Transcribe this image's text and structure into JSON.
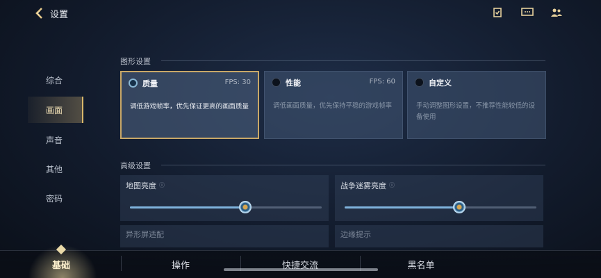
{
  "header": {
    "back_label": "设置",
    "icons": [
      "clipboard-check-icon",
      "chat-icon",
      "friends-icon"
    ]
  },
  "sidebar": {
    "items": [
      {
        "label": "综合"
      },
      {
        "label": "画面",
        "active": true
      },
      {
        "label": "声音"
      },
      {
        "label": "其他"
      },
      {
        "label": "密码"
      }
    ]
  },
  "graphics": {
    "title": "图形设置",
    "presets": [
      {
        "name": "质量",
        "fps": "FPS: 30",
        "desc": "调低游戏帧率，优先保证更高的画面质量",
        "selected": true
      },
      {
        "name": "性能",
        "fps": "FPS: 60",
        "desc": "调低画面质量，优先保持平稳的游戏帧率",
        "selected": false
      },
      {
        "name": "自定义",
        "fps": "",
        "desc": "手动调整图形设置，不推荐性能较低的设备使用",
        "selected": false
      }
    ]
  },
  "advanced": {
    "title": "高级设置",
    "map_brightness": {
      "label": "地图亮度",
      "info": "ⓘ",
      "value": 0.5
    },
    "fog_brightness": {
      "label": "战争迷雾亮度",
      "info": "ⓘ",
      "value": 0.5
    },
    "notch_label": "异形屏适配",
    "edge_label": "边缘提示"
  },
  "bottom_tabs": [
    {
      "label": "基础",
      "active": true
    },
    {
      "label": "操作"
    },
    {
      "label": "快捷交流"
    },
    {
      "label": "黑名单"
    }
  ],
  "colors": {
    "accent_gold": "#c9a867",
    "slider_blue": "#7fb3dd"
  }
}
